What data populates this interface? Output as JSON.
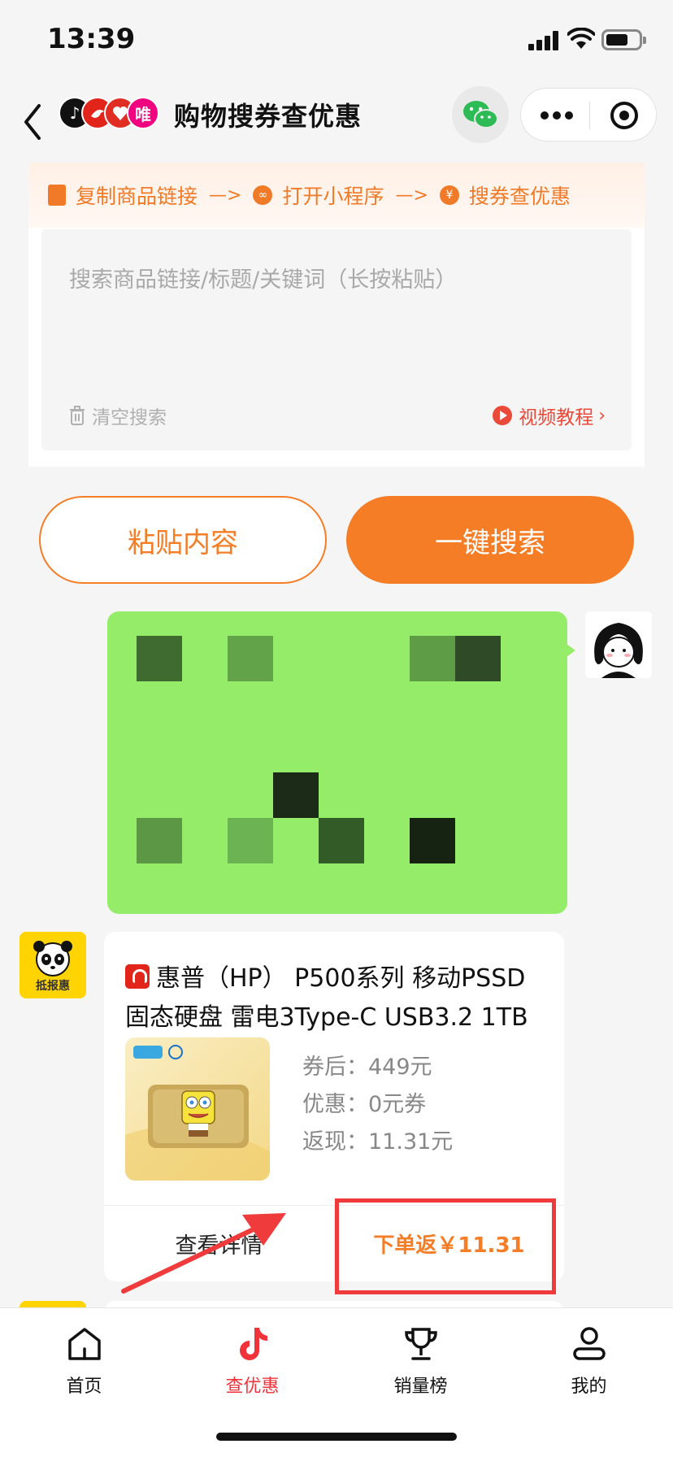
{
  "status_bar": {
    "time": "13:39"
  },
  "nav": {
    "title": "购物搜券查优惠",
    "logos": [
      {
        "name": "douyin",
        "color": "#111111",
        "glyph": "♪"
      },
      {
        "name": "jd",
        "color": "#e1251b",
        "glyph": ""
      },
      {
        "name": "pinduoduo",
        "color": "#e02e24",
        "glyph": ""
      },
      {
        "name": "vipshop",
        "color": "#f10180",
        "glyph": "唯"
      }
    ]
  },
  "steps": {
    "step1": "复制商品链接",
    "arrow": "—>",
    "step2": "打开小程序",
    "step3": "搜券查优惠"
  },
  "search": {
    "placeholder": "搜索商品链接/标题/关键词（长按粘贴）",
    "clear_label": "清空搜索",
    "tutorial_label": "视频教程"
  },
  "actions": {
    "paste_label": "粘贴内容",
    "search_label": "一键搜索"
  },
  "bot": {
    "avatar_text": "抵报惠"
  },
  "product": {
    "platform": "jd",
    "title": "惠普（HP） P500系列 移动PSSD固态硬盘 雷电3Type-C USB3.2 1TB",
    "after_coupon": "券后：449元",
    "discount": "优惠：0元券",
    "cashback": "返现：11.31元",
    "view_details_label": "查看详情",
    "order_label": "下单返￥11.31"
  },
  "tabs": [
    {
      "label": "首页",
      "icon": "home-icon",
      "active": false
    },
    {
      "label": "查优惠",
      "icon": "douyin-icon",
      "active": true
    },
    {
      "label": "销量榜",
      "icon": "trophy-icon",
      "active": false
    },
    {
      "label": "我的",
      "icon": "person-icon",
      "active": false
    }
  ],
  "colors": {
    "accent": "#f57d26",
    "chat_bubble": "#95ec69",
    "active_tab": "#f0323a",
    "highlight": "#ef3b3b"
  }
}
